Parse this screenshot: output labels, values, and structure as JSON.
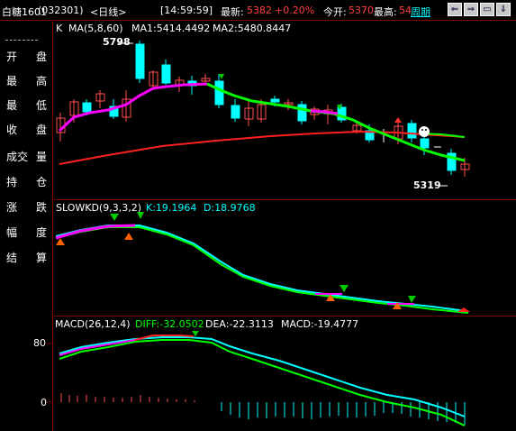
{
  "header": {
    "symbol": "白糖1601",
    "code": "(032301)",
    "period": "<日线>",
    "time": "[14:59:59]",
    "latest_label": "最新:",
    "latest_value": "5382",
    "change_pct": "+0.20%",
    "open_label": "今开:",
    "open_value": "5370",
    "high_label": "最高:",
    "high_value": "54",
    "cycle_btn": "周期",
    "nav_buttons": [
      "⇐",
      "⇒",
      "▭",
      "⇓"
    ]
  },
  "sidebar": {
    "items": [
      {
        "a": "开",
        "b": "盘"
      },
      {
        "a": "最",
        "b": "高"
      },
      {
        "a": "最",
        "b": "低"
      },
      {
        "a": "收",
        "b": "盘"
      },
      {
        "a": "成交",
        "b": "量"
      },
      {
        "a": "持",
        "b": "仓"
      },
      {
        "a": "涨",
        "b": "跌"
      },
      {
        "a": "幅",
        "b": "度"
      },
      {
        "a": "结",
        "b": "算"
      }
    ]
  },
  "main_panel": {
    "k_label": "K",
    "ma_label": "MA(5,8,60)",
    "ma1": "MA1:5414.4492",
    "ma2": "MA2:5480.8447",
    "high_mark": "5798",
    "low_mark": "5319"
  },
  "kd_panel": {
    "title": "SLOWKD(9,3,3,2)",
    "k": "K:19.1964",
    "d": "D:18.9768"
  },
  "macd_panel": {
    "title": "MACD(26,12,4)",
    "diff": "DIFF:-32.0502",
    "dea": "DEA:-22.3113",
    "macd": "MACD:-19.4777",
    "tick_80": "80",
    "tick_0": "0"
  },
  "colors": {
    "up": "#ff5050",
    "down": "#00ffff",
    "ma_green": "#00ff00",
    "ma_magenta": "#ff00ff",
    "ma_red": "#ff2020",
    "grid": "#7a0000"
  }
}
